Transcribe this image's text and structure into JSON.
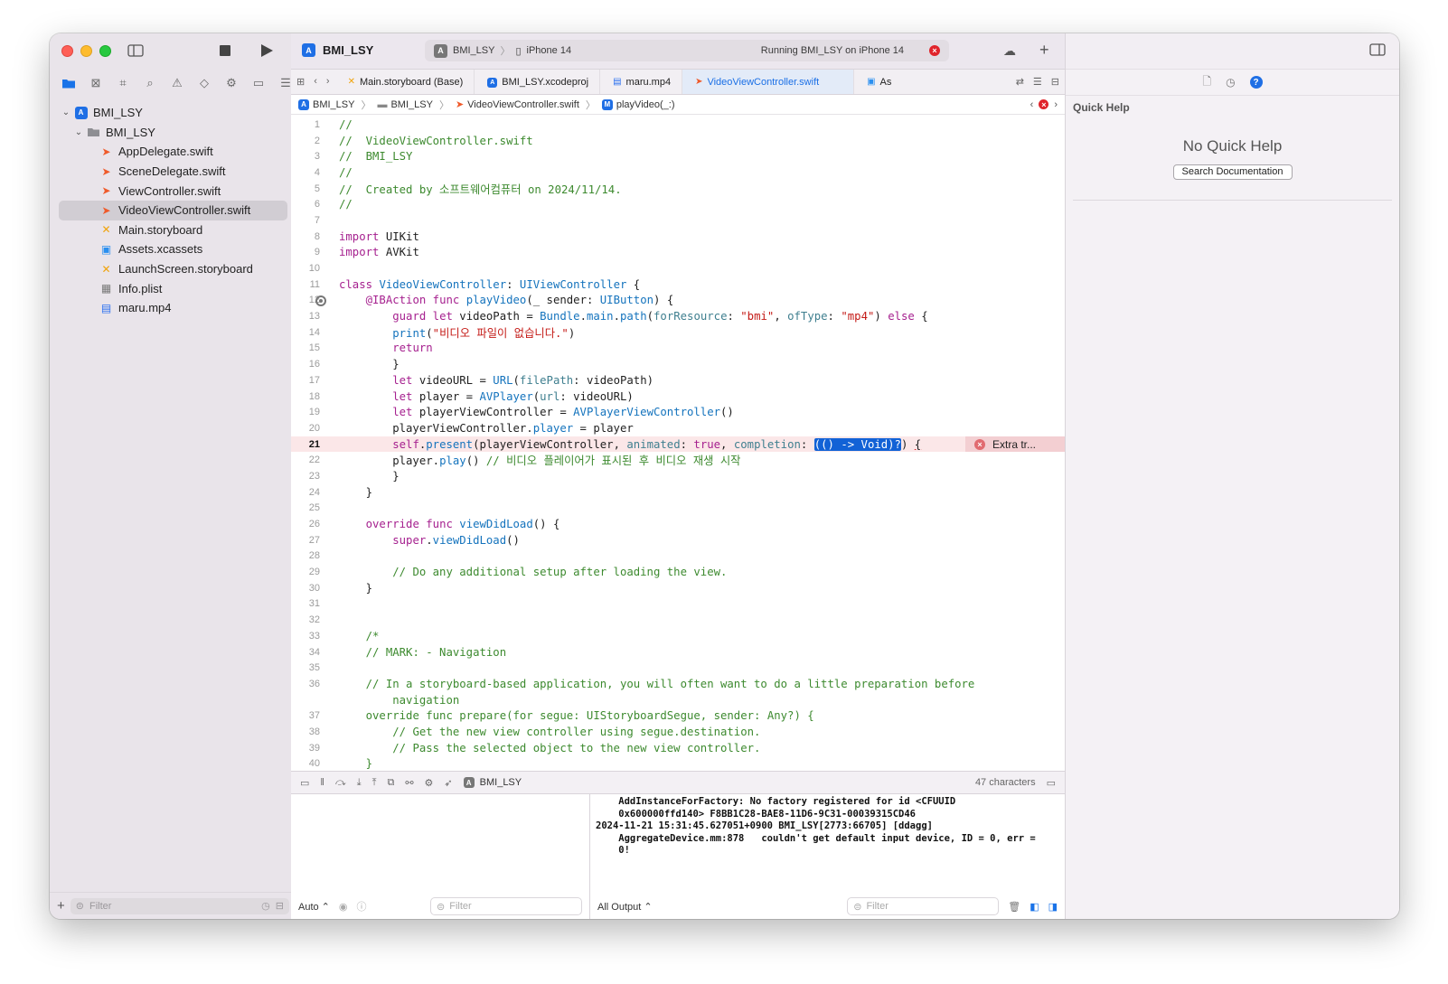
{
  "navigator": {
    "filter_placeholder": "Filter",
    "tree": [
      {
        "label": "BMI_LSY",
        "kind": "project",
        "depth": 0,
        "expanded": true
      },
      {
        "label": "BMI_LSY",
        "kind": "folder",
        "depth": 1,
        "expanded": true
      },
      {
        "label": "AppDelegate.swift",
        "kind": "swift",
        "depth": 2
      },
      {
        "label": "SceneDelegate.swift",
        "kind": "swift",
        "depth": 2
      },
      {
        "label": "ViewController.swift",
        "kind": "swift",
        "depth": 2
      },
      {
        "label": "VideoViewController.swift",
        "kind": "swift",
        "depth": 2,
        "selected": true
      },
      {
        "label": "Main.storyboard",
        "kind": "storyboard",
        "depth": 2
      },
      {
        "label": "Assets.xcassets",
        "kind": "assets",
        "depth": 2
      },
      {
        "label": "LaunchScreen.storyboard",
        "kind": "storyboard",
        "depth": 2
      },
      {
        "label": "Info.plist",
        "kind": "plist",
        "depth": 2
      },
      {
        "label": "maru.mp4",
        "kind": "video",
        "depth": 2
      }
    ]
  },
  "toolbar": {
    "scheme_title": "BMI_LSY",
    "activity_scheme": "BMI_LSY",
    "activity_device": "iPhone 14",
    "activity_status": "Running BMI_LSY on iPhone 14"
  },
  "tabs": [
    {
      "label": "Main.storyboard (Base)",
      "icon": "storyboard-icon",
      "active": false
    },
    {
      "label": "BMI_LSY.xcodeproj",
      "icon": "project-icon",
      "active": false
    },
    {
      "label": "maru.mp4",
      "icon": "video-icon",
      "active": false
    },
    {
      "label": "VideoViewController.swift",
      "icon": "swift-icon",
      "active": true
    },
    {
      "label": "As",
      "icon": "assets-icon",
      "active": false
    }
  ],
  "jumpbar": {
    "project": "BMI_LSY",
    "group": "BMI_LSY",
    "file": "VideoViewController.swift",
    "symbol": "playVideo(_:)"
  },
  "code": {
    "current_line": 21,
    "breakpoint_line": 12,
    "inline_error": "Extra tr...",
    "lines": [
      {
        "n": 1,
        "html": "<span class='c'>//</span>"
      },
      {
        "n": 2,
        "html": "<span class='c'>//  VideoViewController.swift</span>"
      },
      {
        "n": 3,
        "html": "<span class='c'>//  BMI_LSY</span>"
      },
      {
        "n": 4,
        "html": "<span class='c'>//</span>"
      },
      {
        "n": 5,
        "html": "<span class='c'>//  Created by 소프트웨어컴퓨터 on 2024/11/14.</span>"
      },
      {
        "n": 6,
        "html": "<span class='c'>//</span>"
      },
      {
        "n": 7,
        "html": ""
      },
      {
        "n": 8,
        "html": "<span class='k'>import</span> UIKit"
      },
      {
        "n": 9,
        "html": "<span class='k'>import</span> AVKit"
      },
      {
        "n": 10,
        "html": ""
      },
      {
        "n": 11,
        "html": "<span class='k'>class</span> <span class='t'>VideoViewController</span>: <span class='t'>UIViewController</span> {"
      },
      {
        "n": 12,
        "html": "    <span class='k'>@IBAction</span> <span class='k'>func</span> <span class='t'>playVideo</span>(_ sender: <span class='t'>UIButton</span>) {"
      },
      {
        "n": 13,
        "html": "        <span class='k'>guard</span> <span class='k'>let</span> videoPath = <span class='t'>Bundle</span>.<span class='t'>main</span>.<span class='t'>path</span>(<span class='prm'>forResource</span>: <span class='s'>\"bmi\"</span>, <span class='prm'>ofType</span>: <span class='s'>\"mp4\"</span>) <span class='k'>else</span> {"
      },
      {
        "n": 14,
        "html": "        <span class='t'>print</span>(<span class='s'>\"비디오 파일이 없습니다.\"</span>)"
      },
      {
        "n": 15,
        "html": "        <span class='k'>return</span>"
      },
      {
        "n": 16,
        "html": "        }"
      },
      {
        "n": 17,
        "html": "        <span class='k'>let</span> videoURL = <span class='t'>URL</span>(<span class='prm'>filePath</span>: videoPath)"
      },
      {
        "n": 18,
        "html": "        <span class='k'>let</span> player = <span class='t'>AVPlayer</span>(<span class='prm'>url</span>: videoURL)"
      },
      {
        "n": 19,
        "html": "        <span class='k'>let</span> playerViewController = <span class='t'>AVPlayerViewController</span>()"
      },
      {
        "n": 20,
        "html": "        playerViewController.<span class='t'>player</span> = player"
      },
      {
        "n": 21,
        "html": "        <span class='k'>self</span>.<span class='t'>present</span>(playerViewController, <span class='prm'>animated</span>: <span class='k'>true</span>, <span class='prm'>completion</span>: <span class='sel'>(() -&gt; Void)?</span>) <span style='text-decoration: underline; text-decoration-color:#d33;'>{</span>"
      },
      {
        "n": 22,
        "html": "        player.<span class='t'>play</span>() <span class='c'>// 비디오 플레이어가 표시된 후 비디오 재생 시작</span>"
      },
      {
        "n": 23,
        "html": "        }"
      },
      {
        "n": 24,
        "html": "    }"
      },
      {
        "n": 25,
        "html": ""
      },
      {
        "n": 26,
        "html": "    <span class='k'>override</span> <span class='k'>func</span> <span class='t'>viewDidLoad</span>() {"
      },
      {
        "n": 27,
        "html": "        <span class='k'>super</span>.<span class='t'>viewDidLoad</span>()"
      },
      {
        "n": 28,
        "html": ""
      },
      {
        "n": 29,
        "html": "        <span class='c'>// Do any additional setup after loading the view.</span>"
      },
      {
        "n": 30,
        "html": "    }"
      },
      {
        "n": 31,
        "html": ""
      },
      {
        "n": 32,
        "html": ""
      },
      {
        "n": 33,
        "html": "    <span class='c'>/*</span>"
      },
      {
        "n": 34,
        "html": "    <span class='c'>// MARK: - Navigation</span>"
      },
      {
        "n": 35,
        "html": ""
      },
      {
        "n": 36,
        "html": "    <span class='c'>// In a storyboard-based application, you will often want to do a little preparation before</span>"
      },
      {
        "n": "",
        "html": "        <span class='c'>navigation</span>"
      },
      {
        "n": 37,
        "html": "    <span class='c'>override func prepare(for segue: UIStoryboardSegue, sender: Any?) {</span>"
      },
      {
        "n": 38,
        "html": "        <span class='c'>// Get the new view controller using segue.destination.</span>"
      },
      {
        "n": 39,
        "html": "        <span class='c'>// Pass the selected object to the new view controller.</span>"
      },
      {
        "n": 40,
        "html": "    <span class='c'>}</span>"
      }
    ]
  },
  "debug": {
    "scheme_label": "BMI_LSY",
    "char_count": "47 characters",
    "var_mode": "Auto ⌃",
    "output_mode": "All Output ⌃",
    "filter_placeholder": "Filter",
    "console_lines": [
      "    AddInstanceForFactory: No factory registered for id <CFUUID",
      "    0x600000ffd140> F8BB1C28-BAE8-11D6-9C31-00039315CD46",
      "2024-11-21 15:31:45.627051+0900 BMI_LSY[2773:66705] [ddagg]",
      "    AggregateDevice.mm:878   couldn't get default input device, ID = 0, err =",
      "    0!"
    ]
  },
  "inspector": {
    "section_title": "Quick Help",
    "empty_text": "No Quick Help",
    "search_button": "Search Documentation"
  }
}
